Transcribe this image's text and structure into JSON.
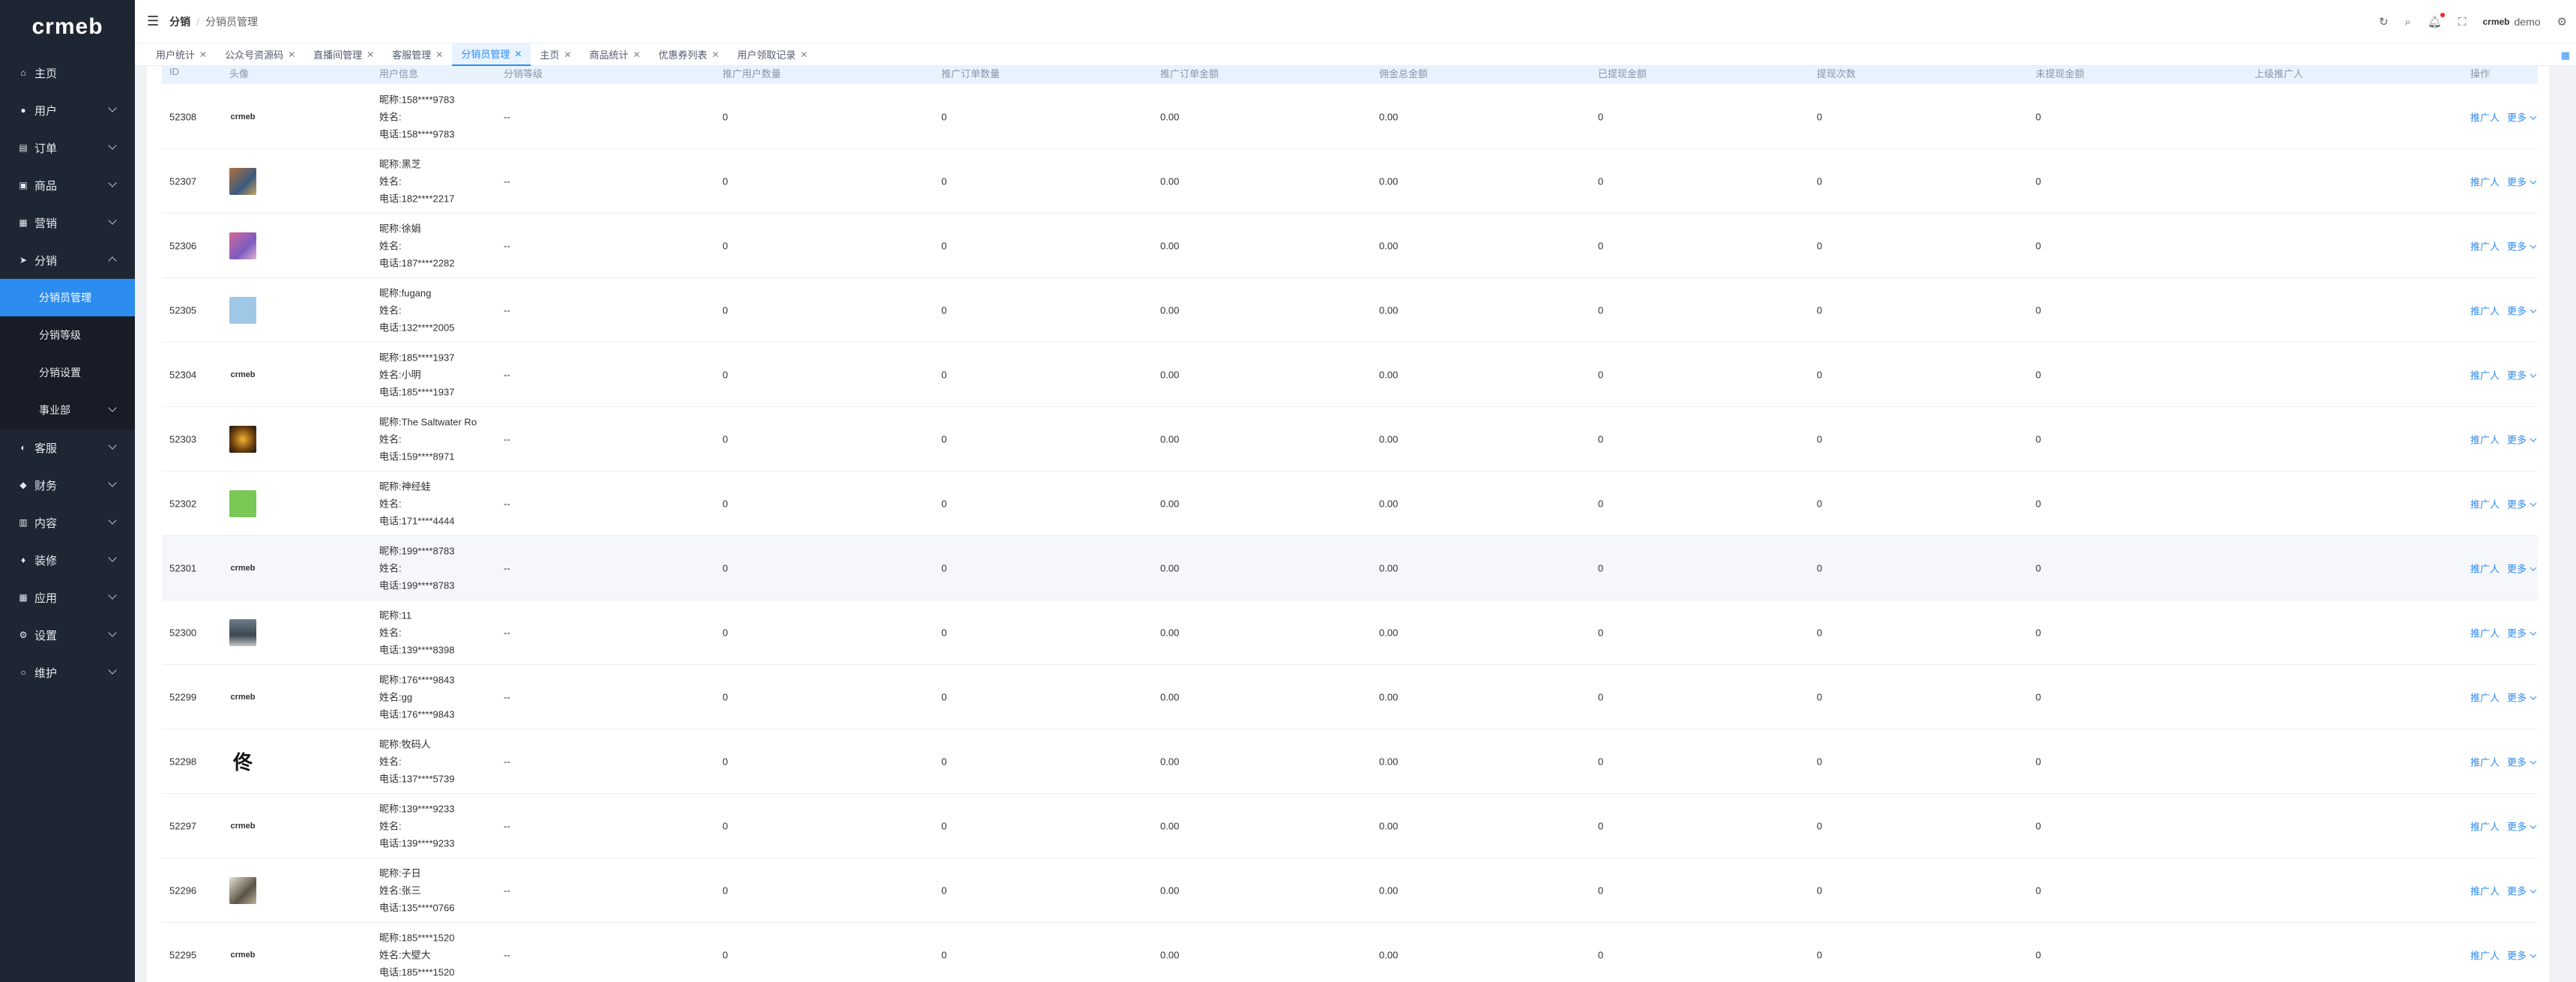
{
  "brand": {
    "logo_text": "crmeb"
  },
  "sidebar": {
    "items": [
      {
        "label": "主页",
        "icon": "home-icon"
      },
      {
        "label": "用户",
        "icon": "user-icon"
      },
      {
        "label": "订单",
        "icon": "cart-icon"
      },
      {
        "label": "商品",
        "icon": "goods-icon"
      },
      {
        "label": "营销",
        "icon": "marketing-icon"
      },
      {
        "label": "分销",
        "icon": "send-icon"
      },
      {
        "label": "客服",
        "icon": "bell-icon"
      },
      {
        "label": "财务",
        "icon": "finance-icon"
      },
      {
        "label": "内容",
        "icon": "content-icon"
      },
      {
        "label": "装修",
        "icon": "decorate-icon"
      },
      {
        "label": "应用",
        "icon": "apps-icon"
      },
      {
        "label": "设置",
        "icon": "gear-icon"
      },
      {
        "label": "维护",
        "icon": "maintain-icon"
      }
    ],
    "sub_items": [
      {
        "label": "分销员管理"
      },
      {
        "label": "分销等级"
      },
      {
        "label": "分销设置"
      },
      {
        "label": "事业部"
      }
    ]
  },
  "header": {
    "breadcrumb_1": "分销",
    "breadcrumb_sep": "/",
    "breadcrumb_2": "分销员管理",
    "username": "demo",
    "user_logo": "crmeb"
  },
  "tabs": [
    {
      "label": "用户统计"
    },
    {
      "label": "公众号资源码"
    },
    {
      "label": "直播间管理"
    },
    {
      "label": "客服管理"
    },
    {
      "label": "分销员管理"
    },
    {
      "label": "主页"
    },
    {
      "label": "商品统计"
    },
    {
      "label": "优惠券列表"
    },
    {
      "label": "用户领取记录"
    }
  ],
  "table": {
    "columns": [
      "ID",
      "头像",
      "用户信息",
      "分销等级",
      "推广用户数量",
      "推广订单数量",
      "推广订单金额",
      "佣金总金额",
      "已提现金额",
      "提现次数",
      "未提现金额",
      "上级推广人",
      "操作"
    ],
    "action_promoter": "推广人",
    "action_more": "更多",
    "rows": [
      {
        "id": "52308",
        "avatar": "logo",
        "nickname": "昵称:158****9783",
        "name": "姓名:",
        "phone": "电话:158****9783",
        "level": "--",
        "users": "0",
        "orders": "0",
        "amount": "0.00",
        "commission": "0.00",
        "withdrawn": "0",
        "times": "0",
        "remaining": "0"
      },
      {
        "id": "52307",
        "avatar": "img1",
        "nickname": "昵称:黑芝",
        "name": "姓名:",
        "phone": "电话:182****2217",
        "level": "--",
        "users": "0",
        "orders": "0",
        "amount": "0.00",
        "commission": "0.00",
        "withdrawn": "0",
        "times": "0",
        "remaining": "0"
      },
      {
        "id": "52306",
        "avatar": "img2",
        "nickname": "昵称:徐娟",
        "name": "姓名:",
        "phone": "电话:187****2282",
        "level": "--",
        "users": "0",
        "orders": "0",
        "amount": "0.00",
        "commission": "0.00",
        "withdrawn": "0",
        "times": "0",
        "remaining": "0"
      },
      {
        "id": "52305",
        "avatar": "img3",
        "nickname": "昵称:fugang",
        "name": "姓名:",
        "phone": "电话:132****2005",
        "level": "--",
        "users": "0",
        "orders": "0",
        "amount": "0.00",
        "commission": "0.00",
        "withdrawn": "0",
        "times": "0",
        "remaining": "0"
      },
      {
        "id": "52304",
        "avatar": "logo",
        "nickname": "昵称:185****1937",
        "name": "姓名:小明",
        "phone": "电话:185****1937",
        "level": "--",
        "users": "0",
        "orders": "0",
        "amount": "0.00",
        "commission": "0.00",
        "withdrawn": "0",
        "times": "0",
        "remaining": "0"
      },
      {
        "id": "52303",
        "avatar": "img4",
        "nickname": "昵称:The Saltwater Ro",
        "name": "姓名:",
        "phone": "电话:159****8971",
        "level": "--",
        "users": "0",
        "orders": "0",
        "amount": "0.00",
        "commission": "0.00",
        "withdrawn": "0",
        "times": "0",
        "remaining": "0"
      },
      {
        "id": "52302",
        "avatar": "img5",
        "nickname": "昵称:神经蛙",
        "name": "姓名:",
        "phone": "电话:171****4444",
        "level": "--",
        "users": "0",
        "orders": "0",
        "amount": "0.00",
        "commission": "0.00",
        "withdrawn": "0",
        "times": "0",
        "remaining": "0"
      },
      {
        "id": "52301",
        "avatar": "logo",
        "nickname": "昵称:199****8783",
        "name": "姓名:",
        "phone": "电话:199****8783",
        "level": "--",
        "users": "0",
        "orders": "0",
        "amount": "0.00",
        "commission": "0.00",
        "withdrawn": "0",
        "times": "0",
        "remaining": "0"
      },
      {
        "id": "52300",
        "avatar": "img6",
        "nickname": "昵称:11",
        "name": "姓名:",
        "phone": "电话:139****8398",
        "level": "--",
        "users": "0",
        "orders": "0",
        "amount": "0.00",
        "commission": "0.00",
        "withdrawn": "0",
        "times": "0",
        "remaining": "0"
      },
      {
        "id": "52299",
        "avatar": "logo",
        "nickname": "昵称:176****9843",
        "name": "姓名:gg",
        "phone": "电话:176****9843",
        "level": "--",
        "users": "0",
        "orders": "0",
        "amount": "0.00",
        "commission": "0.00",
        "withdrawn": "0",
        "times": "0",
        "remaining": "0"
      },
      {
        "id": "52298",
        "avatar": "img7",
        "nickname": "昵称:牧码人",
        "name": "姓名:",
        "phone": "电话:137****5739",
        "level": "--",
        "users": "0",
        "orders": "0",
        "amount": "0.00",
        "commission": "0.00",
        "withdrawn": "0",
        "times": "0",
        "remaining": "0"
      },
      {
        "id": "52297",
        "avatar": "logo",
        "nickname": "昵称:139****9233",
        "name": "姓名:",
        "phone": "电话:139****9233",
        "level": "--",
        "users": "0",
        "orders": "0",
        "amount": "0.00",
        "commission": "0.00",
        "withdrawn": "0",
        "times": "0",
        "remaining": "0"
      },
      {
        "id": "52296",
        "avatar": "img8",
        "nickname": "昵称:子日",
        "name": "姓名:张三",
        "phone": "电话:135****0766",
        "level": "--",
        "users": "0",
        "orders": "0",
        "amount": "0.00",
        "commission": "0.00",
        "withdrawn": "0",
        "times": "0",
        "remaining": "0"
      },
      {
        "id": "52295",
        "avatar": "logo",
        "nickname": "昵称:185****1520",
        "name": "姓名:大壁大",
        "phone": "电话:185****1520",
        "level": "--",
        "users": "0",
        "orders": "0",
        "amount": "0.00",
        "commission": "0.00",
        "withdrawn": "0",
        "times": "0",
        "remaining": "0"
      }
    ]
  },
  "colors": {
    "primary": "#2d8cf0",
    "sidebar_bg": "#1f2633",
    "header_row_bg": "#e8f3ff"
  }
}
